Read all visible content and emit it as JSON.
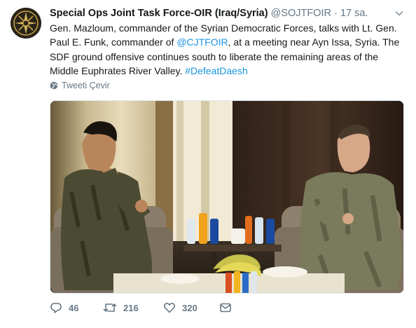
{
  "tweet": {
    "display_name": "Special Ops Joint Task Force-OIR (Iraq/Syria)",
    "handle": "@SOJTFOIR",
    "separator": "·",
    "time": "17 sa.",
    "text_part1": "Gen. Mazloum, commander of the Syrian Democratic Forces, talks with Lt. Gen. Paul E. Funk, commander of ",
    "mention": "@CJTFOIR",
    "text_part2": ", at a meeting near Ayn Issa, Syria. The SDF ground offensive continues south to liberate the remaining areas of the Middle Euphrates River Valley. ",
    "hashtag": "#DefeatDaesh",
    "translate_label": "Tweeti Çevir"
  },
  "actions": {
    "reply_count": "46",
    "retweet_count": "216",
    "like_count": "320"
  },
  "colors": {
    "link": "#1b95e0",
    "muted": "#657786",
    "text": "#14171a"
  }
}
